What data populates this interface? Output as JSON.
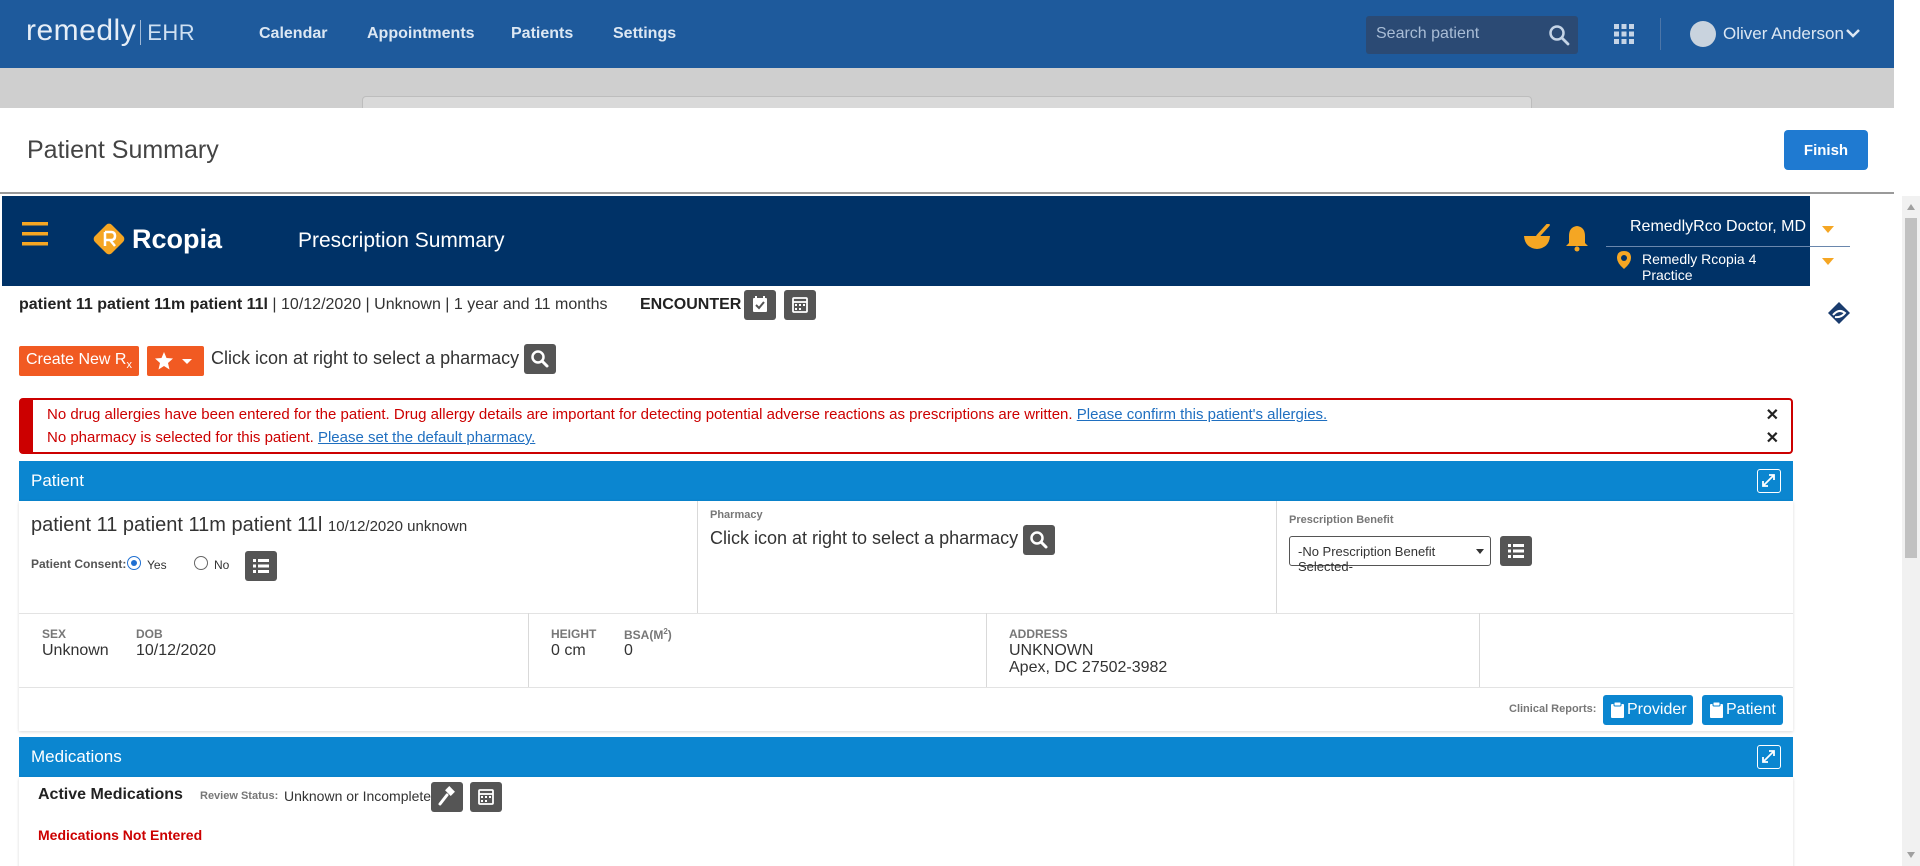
{
  "topnav": {
    "brand": "remedly",
    "brand_suffix": "EHR",
    "links": [
      "Calendar",
      "Appointments",
      "Patients",
      "Settings"
    ],
    "search_placeholder": "Search patient",
    "user": "Oliver Anderson"
  },
  "page": {
    "title": "Patient Summary",
    "finish_label": "Finish"
  },
  "rcopia": {
    "logo": "Rcopia",
    "title": "Prescription Summary",
    "doctor": "RemedlyRco Doctor, MD",
    "practice": "Remedly Rcopia 4 Practice"
  },
  "patient_line": {
    "name": "patient 11 patient 11m patient 11l",
    "details": " | 10/12/2020 | Unknown | 1 year and 11 months",
    "encounter": "ENCOUNTER"
  },
  "actions": {
    "create_rx": "Create New R",
    "create_rx_sub": "x",
    "pharmacy_hint": "Click icon at right to select a pharmacy"
  },
  "alerts": [
    {
      "text": "No drug allergies have been entered for the patient. Drug allergy details are important for detecting potential adverse reactions as prescriptions are written. ",
      "link": "Please confirm this patient's allergies."
    },
    {
      "text": "No pharmacy is selected for this patient. ",
      "link": "Please set the default pharmacy."
    }
  ],
  "patient_panel": {
    "title": "Patient",
    "name": "patient 11 patient 11m patient 11l",
    "name_meta": "10/12/2020 unknown",
    "consent_label": "Patient Consent:",
    "consent_yes": "Yes",
    "consent_no": "No",
    "pharmacy_label": "Pharmacy",
    "pharmacy_hint": "Click icon at right to select a pharmacy",
    "benefit_label": "Prescription Benefit",
    "benefit_value": "-No Prescription Benefit Selected-",
    "sex_label": "SEX",
    "sex": "Unknown",
    "dob_label": "DOB",
    "dob": "10/12/2020",
    "height_label": "HEIGHT",
    "height": "0 cm",
    "bsa_label": "BSA(M",
    "bsa_sup": "2",
    "bsa_close": ")",
    "bsa": "0",
    "address_label": "ADDRESS",
    "address_line1": "UNKNOWN",
    "address_line2": "Apex, DC 27502-3982",
    "reports_label": "Clinical Reports:",
    "provider_btn": "Provider",
    "patient_btn": "Patient"
  },
  "medications": {
    "title": "Medications",
    "active_label": "Active Medications",
    "review_label": "Review Status:",
    "review_value": "Unknown or Incomplete",
    "empty_text": "Medications Not Entered"
  },
  "colors": {
    "nav": "#1e5a9c",
    "rcopia_header": "#003267",
    "panel_blue": "#0b86d0",
    "alert_red": "#cc0000",
    "accent_orange": "#f15a22",
    "icon_yellow": "#f5a623"
  }
}
